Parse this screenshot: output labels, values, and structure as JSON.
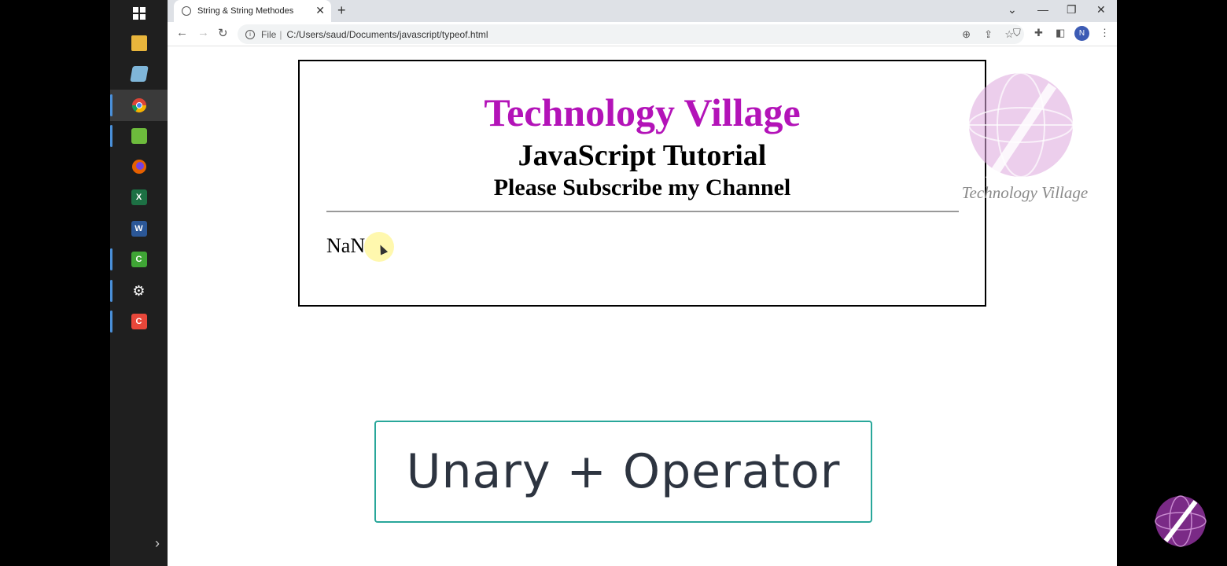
{
  "taskbar": {
    "icons": [
      "windows-start-icon",
      "file-explorer-icon",
      "notepad-icon",
      "chrome-icon",
      "photo-editor-icon",
      "firefox-icon",
      "excel-icon",
      "word-icon",
      "camtasia-icon",
      "settings-icon",
      "camtasia-recorder-icon"
    ],
    "active": "chrome-icon"
  },
  "browser": {
    "tab_title": "String & String Methodes",
    "address_scheme": "File",
    "address_url": "C:/Users/saud/Documents/javascript/typeof.html",
    "profile_initial": "N"
  },
  "page": {
    "brand_title": "Technology Village",
    "tutorial_title": "JavaScript Tutorial",
    "subscribe_text": "Please Subscribe my Channel",
    "output": "NaN"
  },
  "overlay": {
    "watermark_text": "Technology Village",
    "caption": "Unary + Operator"
  },
  "colors": {
    "brand": "#b313b8",
    "caption_border": "#29a79a",
    "caption_text": "#2d3440",
    "watermark_globe": "#d8a0d8"
  }
}
